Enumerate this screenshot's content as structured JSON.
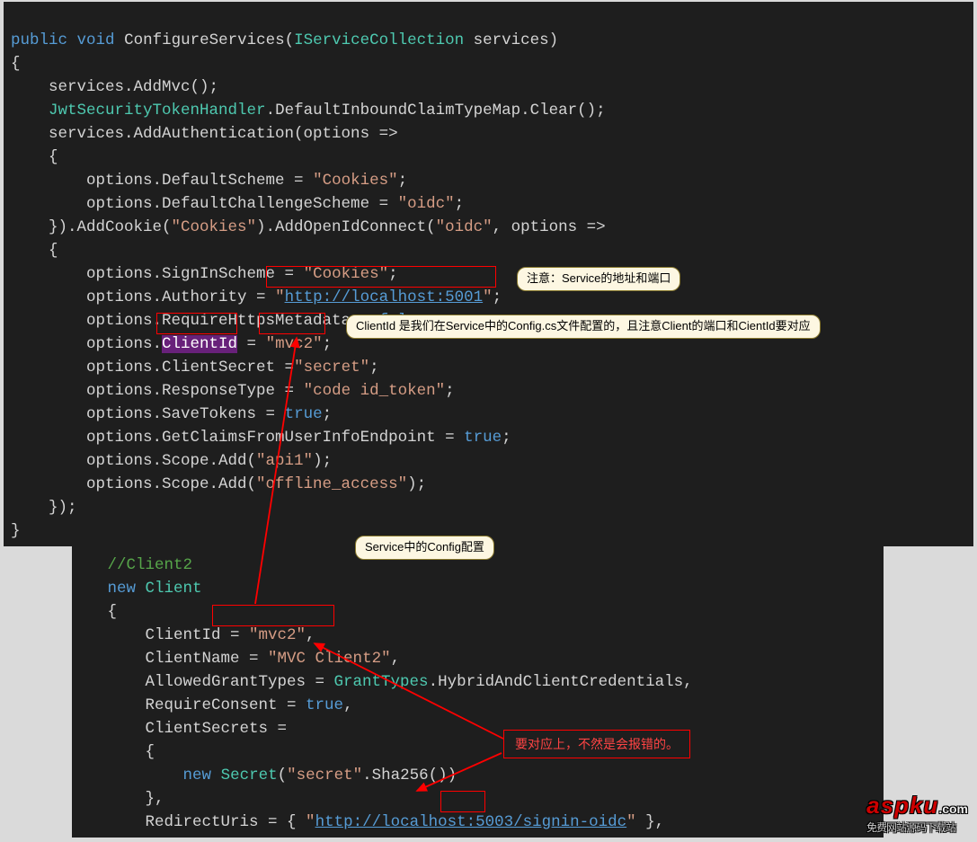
{
  "top_code": {
    "t0": {
      "public": "public",
      "void_": "void",
      "fn": "ConfigureServices",
      "iface": "IServiceCollection",
      "arg": "services",
      "close": ")"
    },
    "t1": "{",
    "t2": "    services.AddMvc();",
    "t3a": "    ",
    "t3type": "JwtSecurityTokenHandler",
    "t3b": ".DefaultInboundClaimTypeMap.Clear();",
    "t4": "    services.AddAuthentication(options =>",
    "t5": "    {",
    "t6a": "        options.DefaultScheme = ",
    "t6s": "\"Cookies\"",
    "t6b": ";",
    "t7a": "        options.DefaultChallengeScheme = ",
    "t7s": "\"oidc\"",
    "t7b": ";",
    "t8a": "    }).AddCookie(",
    "t8s": "\"Cookies\"",
    "t8b": ").AddOpenIdConnect(",
    "t8s2": "\"oidc\"",
    "t8c": ", options =>",
    "t9": "    {",
    "t10a": "        options.SignInScheme = ",
    "t10s": "\"Cookies\"",
    "t10b": ";",
    "t11a": "        options.Authority = ",
    "t11q": "\"",
    "t11link": "http://localhost:5001",
    "t11q2": "\"",
    "t11b": ";",
    "t12a": "        options.RequireHttpsMetadata = ",
    "t12v": "false",
    "t12b": ";",
    "t13a": "        options.",
    "t13sel": "ClientId",
    "t13b": " = ",
    "t13s": "\"mvc2\"",
    "t13c": ";",
    "t14a": "        options.ClientSecret =",
    "t14s": "\"secret\"",
    "t14b": ";",
    "t15a": "        options.ResponseType = ",
    "t15s": "\"code id_token\"",
    "t15b": ";",
    "t16a": "        options.SaveTokens = ",
    "t16v": "true",
    "t16b": ";",
    "t17a": "        options.GetClaimsFromUserInfoEndpoint = ",
    "t17v": "true",
    "t17b": ";",
    "t18a": "        options.Scope.Add(",
    "t18s": "\"api1\"",
    "t18b": ");",
    "t19a": "        options.Scope.Add(",
    "t19s": "\"offline_access\"",
    "t19b": ");",
    "t20": "    });",
    "t21": "}"
  },
  "bottom_code": {
    "b1": "   //Client2",
    "b2a": "   ",
    "b2kw": "new",
    "b2sp": " ",
    "b2type": "Client",
    "b3": "   {",
    "b4a": "       ClientId = ",
    "b4s": "\"mvc2\"",
    "b4b": ",",
    "b5a": "       ClientName = ",
    "b5s": "\"MVC Client2\"",
    "b5b": ",",
    "b6a": "       AllowedGrantTypes = ",
    "b6type": "GrantTypes",
    "b6b": ".HybridAndClientCredentials,",
    "b7a": "       RequireConsent = ",
    "b7v": "true",
    "b7b": ",",
    "b8": "       ClientSecrets =",
    "b9": "       {",
    "b10a": "           ",
    "b10kw": "new",
    "b10sp": " ",
    "b10type": "Secret",
    "b10b": "(",
    "b10s": "\"secret\"",
    "b10c": ".Sha256())",
    "b11": "       },",
    "b12a": "       RedirectUris = { ",
    "b12q": "\"",
    "b12link": "http://localhost:5003/signin-oidc",
    "b12q2": "\"",
    "b12b": " },"
  },
  "callouts": {
    "authority_note": "注意：Service的地址和端口",
    "clientid_note": "ClientId 是我们在Service中的Config.cs文件配置的，且注意Client的端口和CientId要对应",
    "config_note": "Service中的Config配置",
    "match_note": "要对应上，不然是会报错的。"
  },
  "watermark": {
    "brand": "aspku",
    "tld": ".com",
    "tag": "免费网站源码下载站"
  }
}
